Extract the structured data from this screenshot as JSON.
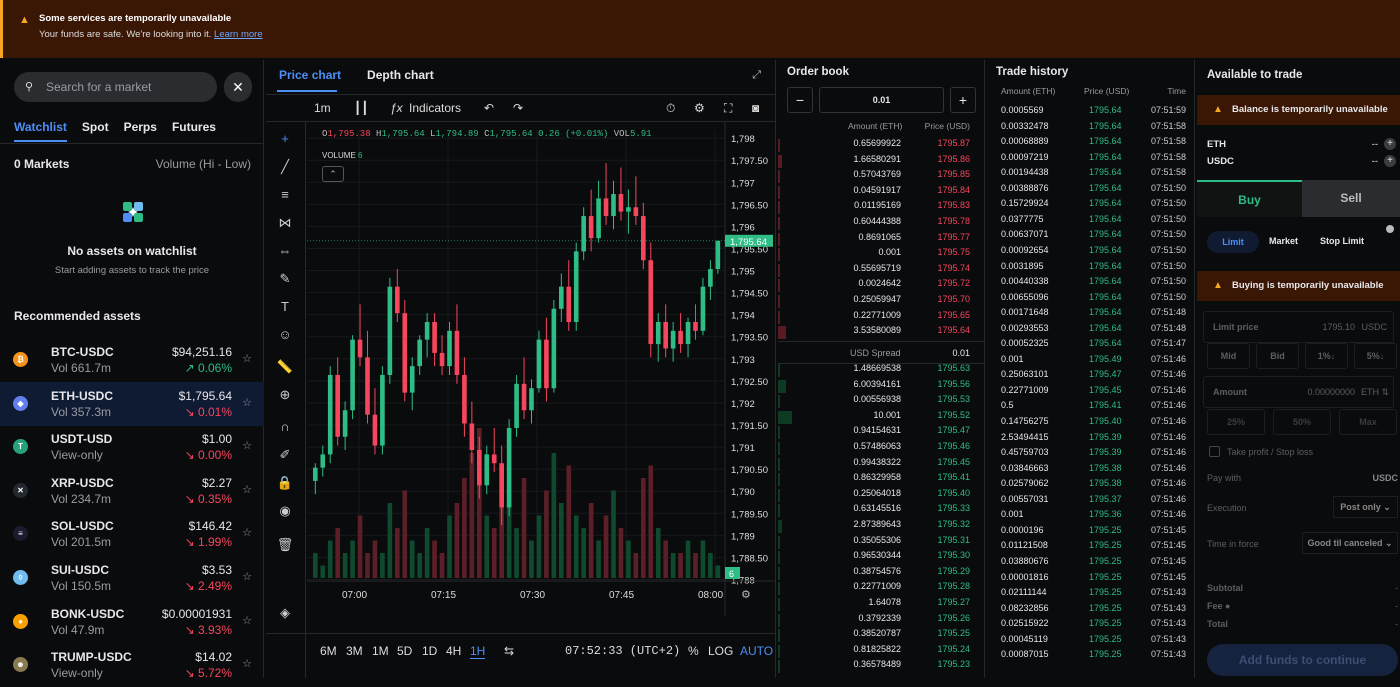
{
  "banner": {
    "title": "Some services are temporarily unavailable",
    "body": "Your funds are safe. We're looking into it.",
    "link": "Learn more"
  },
  "left": {
    "search_placeholder": "Search for a market",
    "tabs": [
      "Watchlist",
      "Spot",
      "Perps",
      "Futures"
    ],
    "markets_count": "0 Markets",
    "sort": "Volume (Hi - Low)",
    "empty_title": "No assets on watchlist",
    "empty_sub": "Start adding assets to track the price",
    "recommended": "Recommended assets",
    "assets": [
      {
        "name": "BTC-USDC",
        "sub": "Vol 661.7m",
        "price": "$94,251.16",
        "change": "↗ 0.06%",
        "dir": "up",
        "color": "#f7931a",
        "glyph": "₿"
      },
      {
        "name": "ETH-USDC",
        "sub": "Vol 357.3m",
        "price": "$1,795.64",
        "change": "↘ 0.01%",
        "dir": "dn",
        "color": "#627eea",
        "glyph": "◆"
      },
      {
        "name": "USDT-USD",
        "sub": "View-only",
        "price": "$1.00",
        "change": "↘ 0.00%",
        "dir": "dn",
        "color": "#26a17b",
        "glyph": "T"
      },
      {
        "name": "XRP-USDC",
        "sub": "Vol 234.7m",
        "price": "$2.27",
        "change": "↘ 0.35%",
        "dir": "dn",
        "color": "#23292f",
        "glyph": "✕"
      },
      {
        "name": "SOL-USDC",
        "sub": "Vol 201.5m",
        "price": "$146.42",
        "change": "↘ 1.99%",
        "dir": "dn",
        "color": "#1b1b2f",
        "glyph": "≡"
      },
      {
        "name": "SUI-USDC",
        "sub": "Vol 150.5m",
        "price": "$3.53",
        "change": "↘ 2.49%",
        "dir": "dn",
        "color": "#6fbcf0",
        "glyph": "◊"
      },
      {
        "name": "BONK-USDC",
        "sub": "Vol 47.9m",
        "price": "$0.00001931",
        "change": "↘ 3.93%",
        "dir": "dn",
        "color": "#f8a000",
        "glyph": "●"
      },
      {
        "name": "TRUMP-USDC",
        "sub": "View-only",
        "price": "$14.02",
        "change": "↘ 5.72%",
        "dir": "dn",
        "color": "#8a7a50",
        "glyph": "☻"
      }
    ]
  },
  "chart": {
    "tabs": [
      "Price chart",
      "Depth chart"
    ],
    "interval": "1m",
    "indicators": "Indicators",
    "ohlc": {
      "o": "1,795.38",
      "h": "1,795.64",
      "l": "1,794.89",
      "c": "1,795.64",
      "chg": "0.26 (+0.01%)",
      "vol": "5.91"
    },
    "volume_label": "VOLUME",
    "volume_value": "6",
    "price_axis": [
      "1,798",
      "1,797.50",
      "1,797",
      "1,796.50",
      "1,796",
      "1,795.50",
      "1,795",
      "1,794.50",
      "1,794",
      "1,793.50",
      "1,793",
      "1,792.50",
      "1,792",
      "1,791.50",
      "1,791",
      "1,790.50",
      "1,790",
      "1,789.50",
      "1,789",
      "1,788.50",
      "1,788"
    ],
    "last_price": "1,795.64",
    "last_volume": "6",
    "time_axis": [
      "07:00",
      "07:15",
      "07:30",
      "07:45",
      "08:00"
    ],
    "ranges": [
      "6M",
      "3M",
      "1M",
      "5D",
      "1D",
      "4H",
      "1H"
    ],
    "active_range": "1H",
    "clock": "07:52:33 (UTC+2)",
    "pct": "%",
    "log": "LOG",
    "auto": "AUTO",
    "series": [
      [
        1790.2,
        1790.6,
        1789.9,
        1790.5
      ],
      [
        1790.5,
        1791.0,
        1790.3,
        1790.8
      ],
      [
        1790.8,
        1792.8,
        1790.6,
        1792.6
      ],
      [
        1792.6,
        1793.0,
        1791.0,
        1791.2
      ],
      [
        1791.2,
        1792.0,
        1790.9,
        1791.8
      ],
      [
        1791.8,
        1793.5,
        1791.6,
        1793.4
      ],
      [
        1793.4,
        1794.2,
        1792.8,
        1793.0
      ],
      [
        1793.0,
        1793.6,
        1791.5,
        1791.7
      ],
      [
        1791.7,
        1792.3,
        1790.8,
        1791.0
      ],
      [
        1791.0,
        1792.8,
        1790.8,
        1792.6
      ],
      [
        1792.6,
        1794.8,
        1792.4,
        1794.6
      ],
      [
        1794.6,
        1795.0,
        1793.8,
        1794.0
      ],
      [
        1794.0,
        1794.3,
        1792.0,
        1792.2
      ],
      [
        1792.2,
        1793.0,
        1791.8,
        1792.8
      ],
      [
        1792.8,
        1793.5,
        1792.6,
        1793.4
      ],
      [
        1793.4,
        1794.0,
        1793.0,
        1793.8
      ],
      [
        1793.8,
        1794.0,
        1792.8,
        1793.1
      ],
      [
        1793.1,
        1793.5,
        1792.6,
        1792.8
      ],
      [
        1792.8,
        1793.8,
        1792.6,
        1793.6
      ],
      [
        1793.6,
        1794.2,
        1792.4,
        1792.6
      ],
      [
        1792.6,
        1793.0,
        1791.2,
        1791.5
      ],
      [
        1791.5,
        1792.0,
        1790.6,
        1790.9
      ],
      [
        1790.9,
        1791.2,
        1789.8,
        1790.1
      ],
      [
        1790.1,
        1791.0,
        1789.9,
        1790.8
      ],
      [
        1790.8,
        1791.4,
        1790.4,
        1790.6
      ],
      [
        1790.6,
        1791.0,
        1789.2,
        1789.6
      ],
      [
        1789.6,
        1791.6,
        1789.4,
        1791.4
      ],
      [
        1791.4,
        1792.6,
        1791.2,
        1792.4
      ],
      [
        1792.4,
        1793.0,
        1791.6,
        1791.8
      ],
      [
        1791.8,
        1792.5,
        1791.5,
        1792.3
      ],
      [
        1792.3,
        1793.6,
        1792.2,
        1793.4
      ],
      [
        1793.4,
        1793.9,
        1792.0,
        1792.3
      ],
      [
        1792.3,
        1794.3,
        1792.2,
        1794.1
      ],
      [
        1794.1,
        1794.9,
        1793.8,
        1794.6
      ],
      [
        1794.6,
        1795.2,
        1793.6,
        1793.8
      ],
      [
        1793.8,
        1795.6,
        1793.6,
        1795.4
      ],
      [
        1795.4,
        1796.4,
        1795.2,
        1796.2
      ],
      [
        1796.2,
        1796.8,
        1795.4,
        1795.7
      ],
      [
        1795.7,
        1797.0,
        1795.6,
        1796.6
      ],
      [
        1796.6,
        1797.4,
        1796.0,
        1796.2
      ],
      [
        1796.2,
        1797.0,
        1795.9,
        1796.7
      ],
      [
        1796.7,
        1797.3,
        1796.1,
        1796.3
      ],
      [
        1796.3,
        1796.8,
        1795.8,
        1796.4
      ],
      [
        1796.4,
        1797.1,
        1796.0,
        1796.2
      ],
      [
        1796.2,
        1796.5,
        1795.0,
        1795.2
      ],
      [
        1795.2,
        1795.6,
        1793.0,
        1793.3
      ],
      [
        1793.3,
        1794.0,
        1792.9,
        1793.8
      ],
      [
        1793.8,
        1794.2,
        1793.0,
        1793.2
      ],
      [
        1793.2,
        1793.8,
        1792.9,
        1793.6
      ],
      [
        1793.6,
        1794.0,
        1793.1,
        1793.3
      ],
      [
        1793.3,
        1793.9,
        1793.0,
        1793.8
      ],
      [
        1793.8,
        1794.2,
        1793.4,
        1793.6
      ],
      [
        1793.6,
        1794.8,
        1793.5,
        1794.6
      ],
      [
        1794.6,
        1795.2,
        1794.3,
        1795.0
      ],
      [
        1795.0,
        1795.64,
        1794.89,
        1795.64
      ]
    ],
    "volumes": [
      2,
      1,
      3,
      4,
      2,
      3,
      5,
      2,
      3,
      2,
      6,
      4,
      7,
      3,
      2,
      4,
      3,
      2,
      5,
      6,
      8,
      10,
      12,
      5,
      4,
      9,
      6,
      4,
      8,
      3,
      5,
      7,
      10,
      6,
      9,
      5,
      4,
      6,
      3,
      5,
      7,
      4,
      3,
      2,
      8,
      9,
      4,
      3,
      2,
      2,
      3,
      2,
      3,
      2,
      1
    ]
  },
  "orderbook": {
    "title": "Order book",
    "step": "0.01",
    "h_amount": "Amount (ETH)",
    "h_price": "Price (USD)",
    "asks": [
      [
        "0.65699922",
        "1795.87"
      ],
      [
        "1.66580291",
        "1795.86"
      ],
      [
        "0.57043769",
        "1795.85"
      ],
      [
        "0.04591917",
        "1795.84"
      ],
      [
        "0.01195169",
        "1795.83"
      ],
      [
        "0.60444388",
        "1795.78"
      ],
      [
        "0.8691065",
        "1795.77"
      ],
      [
        "0.001",
        "1795.75"
      ],
      [
        "0.55695719",
        "1795.74"
      ],
      [
        "0.0024642",
        "1795.72"
      ],
      [
        "0.25059947",
        "1795.70"
      ],
      [
        "0.22771009",
        "1795.65"
      ],
      [
        "3.53580089",
        "1795.64"
      ]
    ],
    "spread_label": "USD Spread",
    "spread": "0.01",
    "bids": [
      [
        "1.48669538",
        "1795.63"
      ],
      [
        "6.00394161",
        "1795.56"
      ],
      [
        "0.00556938",
        "1795.53"
      ],
      [
        "10.001",
        "1795.52"
      ],
      [
        "0.94154631",
        "1795.47"
      ],
      [
        "0.57486063",
        "1795.46"
      ],
      [
        "0.99438322",
        "1795.45"
      ],
      [
        "0.86329958",
        "1795.41"
      ],
      [
        "0.25064018",
        "1795.40"
      ],
      [
        "0.63145516",
        "1795.33"
      ],
      [
        "2.87389643",
        "1795.32"
      ],
      [
        "0.35055306",
        "1795.31"
      ],
      [
        "0.96530344",
        "1795.30"
      ],
      [
        "0.38754576",
        "1795.29"
      ],
      [
        "0.22771009",
        "1795.28"
      ],
      [
        "1.64078",
        "1795.27"
      ],
      [
        "0.3792339",
        "1795.26"
      ],
      [
        "0.38520787",
        "1795.25"
      ],
      [
        "0.81825822",
        "1795.24"
      ],
      [
        "0.36578489",
        "1795.23"
      ]
    ]
  },
  "history": {
    "title": "Trade history",
    "h_amount": "Amount (ETH)",
    "h_price": "Price (USD)",
    "h_time": "Time",
    "rows": [
      [
        "0.0005569",
        "1795.64",
        "07:51:59"
      ],
      [
        "0.00332478",
        "1795.64",
        "07:51:58"
      ],
      [
        "0.00068889",
        "1795.64",
        "07:51:58"
      ],
      [
        "0.00097219",
        "1795.64",
        "07:51:58"
      ],
      [
        "0.00194438",
        "1795.64",
        "07:51:58"
      ],
      [
        "0.00388876",
        "1795.64",
        "07:51:50"
      ],
      [
        "0.15729924",
        "1795.64",
        "07:51:50"
      ],
      [
        "0.0377775",
        "1795.64",
        "07:51:50"
      ],
      [
        "0.00637071",
        "1795.64",
        "07:51:50"
      ],
      [
        "0.00092654",
        "1795.64",
        "07:51:50"
      ],
      [
        "0.0031895",
        "1795.64",
        "07:51:50"
      ],
      [
        "0.00440338",
        "1795.64",
        "07:51:50"
      ],
      [
        "0.00655096",
        "1795.64",
        "07:51:50"
      ],
      [
        "0.00171648",
        "1795.64",
        "07:51:48"
      ],
      [
        "0.00293553",
        "1795.64",
        "07:51:48"
      ],
      [
        "0.00052325",
        "1795.64",
        "07:51:47"
      ],
      [
        "0.001",
        "1795.49",
        "07:51:46"
      ],
      [
        "0.25063101",
        "1795.47",
        "07:51:46"
      ],
      [
        "0.22771009",
        "1795.45",
        "07:51:46"
      ],
      [
        "0.5",
        "1795.41",
        "07:51:46"
      ],
      [
        "0.14756275",
        "1795.40",
        "07:51:46"
      ],
      [
        "2.53494415",
        "1795.39",
        "07:51:46"
      ],
      [
        "0.45759703",
        "1795.39",
        "07:51:46"
      ],
      [
        "0.03846663",
        "1795.38",
        "07:51:46"
      ],
      [
        "0.02579062",
        "1795.38",
        "07:51:46"
      ],
      [
        "0.00557031",
        "1795.37",
        "07:51:46"
      ],
      [
        "0.001",
        "1795.36",
        "07:51:46"
      ],
      [
        "0.0000196",
        "1795.25",
        "07:51:45"
      ],
      [
        "0.01121508",
        "1795.25",
        "07:51:45"
      ],
      [
        "0.03880676",
        "1795.25",
        "07:51:45"
      ],
      [
        "0.00001816",
        "1795.25",
        "07:51:45"
      ],
      [
        "0.02111144",
        "1795.25",
        "07:51:43"
      ],
      [
        "0.08232856",
        "1795.25",
        "07:51:43"
      ],
      [
        "0.02515922",
        "1795.25",
        "07:51:43"
      ],
      [
        "0.00045119",
        "1795.25",
        "07:51:43"
      ],
      [
        "0.00087015",
        "1795.25",
        "07:51:43"
      ]
    ]
  },
  "trade": {
    "title": "Available to trade",
    "balance_alert": "Balance is temporarily unavailable",
    "assets": [
      {
        "sym": "ETH",
        "val": "--"
      },
      {
        "sym": "USDC",
        "val": "--"
      }
    ],
    "buy": "Buy",
    "sell": "Sell",
    "order_types": [
      "Limit",
      "Market",
      "Stop Limit"
    ],
    "buying_alert": "Buying is temporarily unavailable",
    "limit_label": "Limit price",
    "limit_value": "1795.10",
    "limit_unit": "USDC",
    "quick": [
      "Mid",
      "Bid",
      "1%↓",
      "5%↓"
    ],
    "amount_label": "Amount",
    "amount_value": "0.00000000",
    "amount_unit": "ETH ⇅",
    "pcts": [
      "25%",
      "50%",
      "Max"
    ],
    "tpsl": "Take profit / Stop loss",
    "pay_with": "Pay with",
    "pay_value": "USDC",
    "execution": "Execution",
    "execution_value": "Post only ⌄",
    "tif": "Time in force",
    "tif_value": "Good til canceled ⌄",
    "subtotal": "Subtotal",
    "fee": "Fee",
    "total": "Total",
    "dash": "-",
    "cta": "Add funds to continue"
  }
}
